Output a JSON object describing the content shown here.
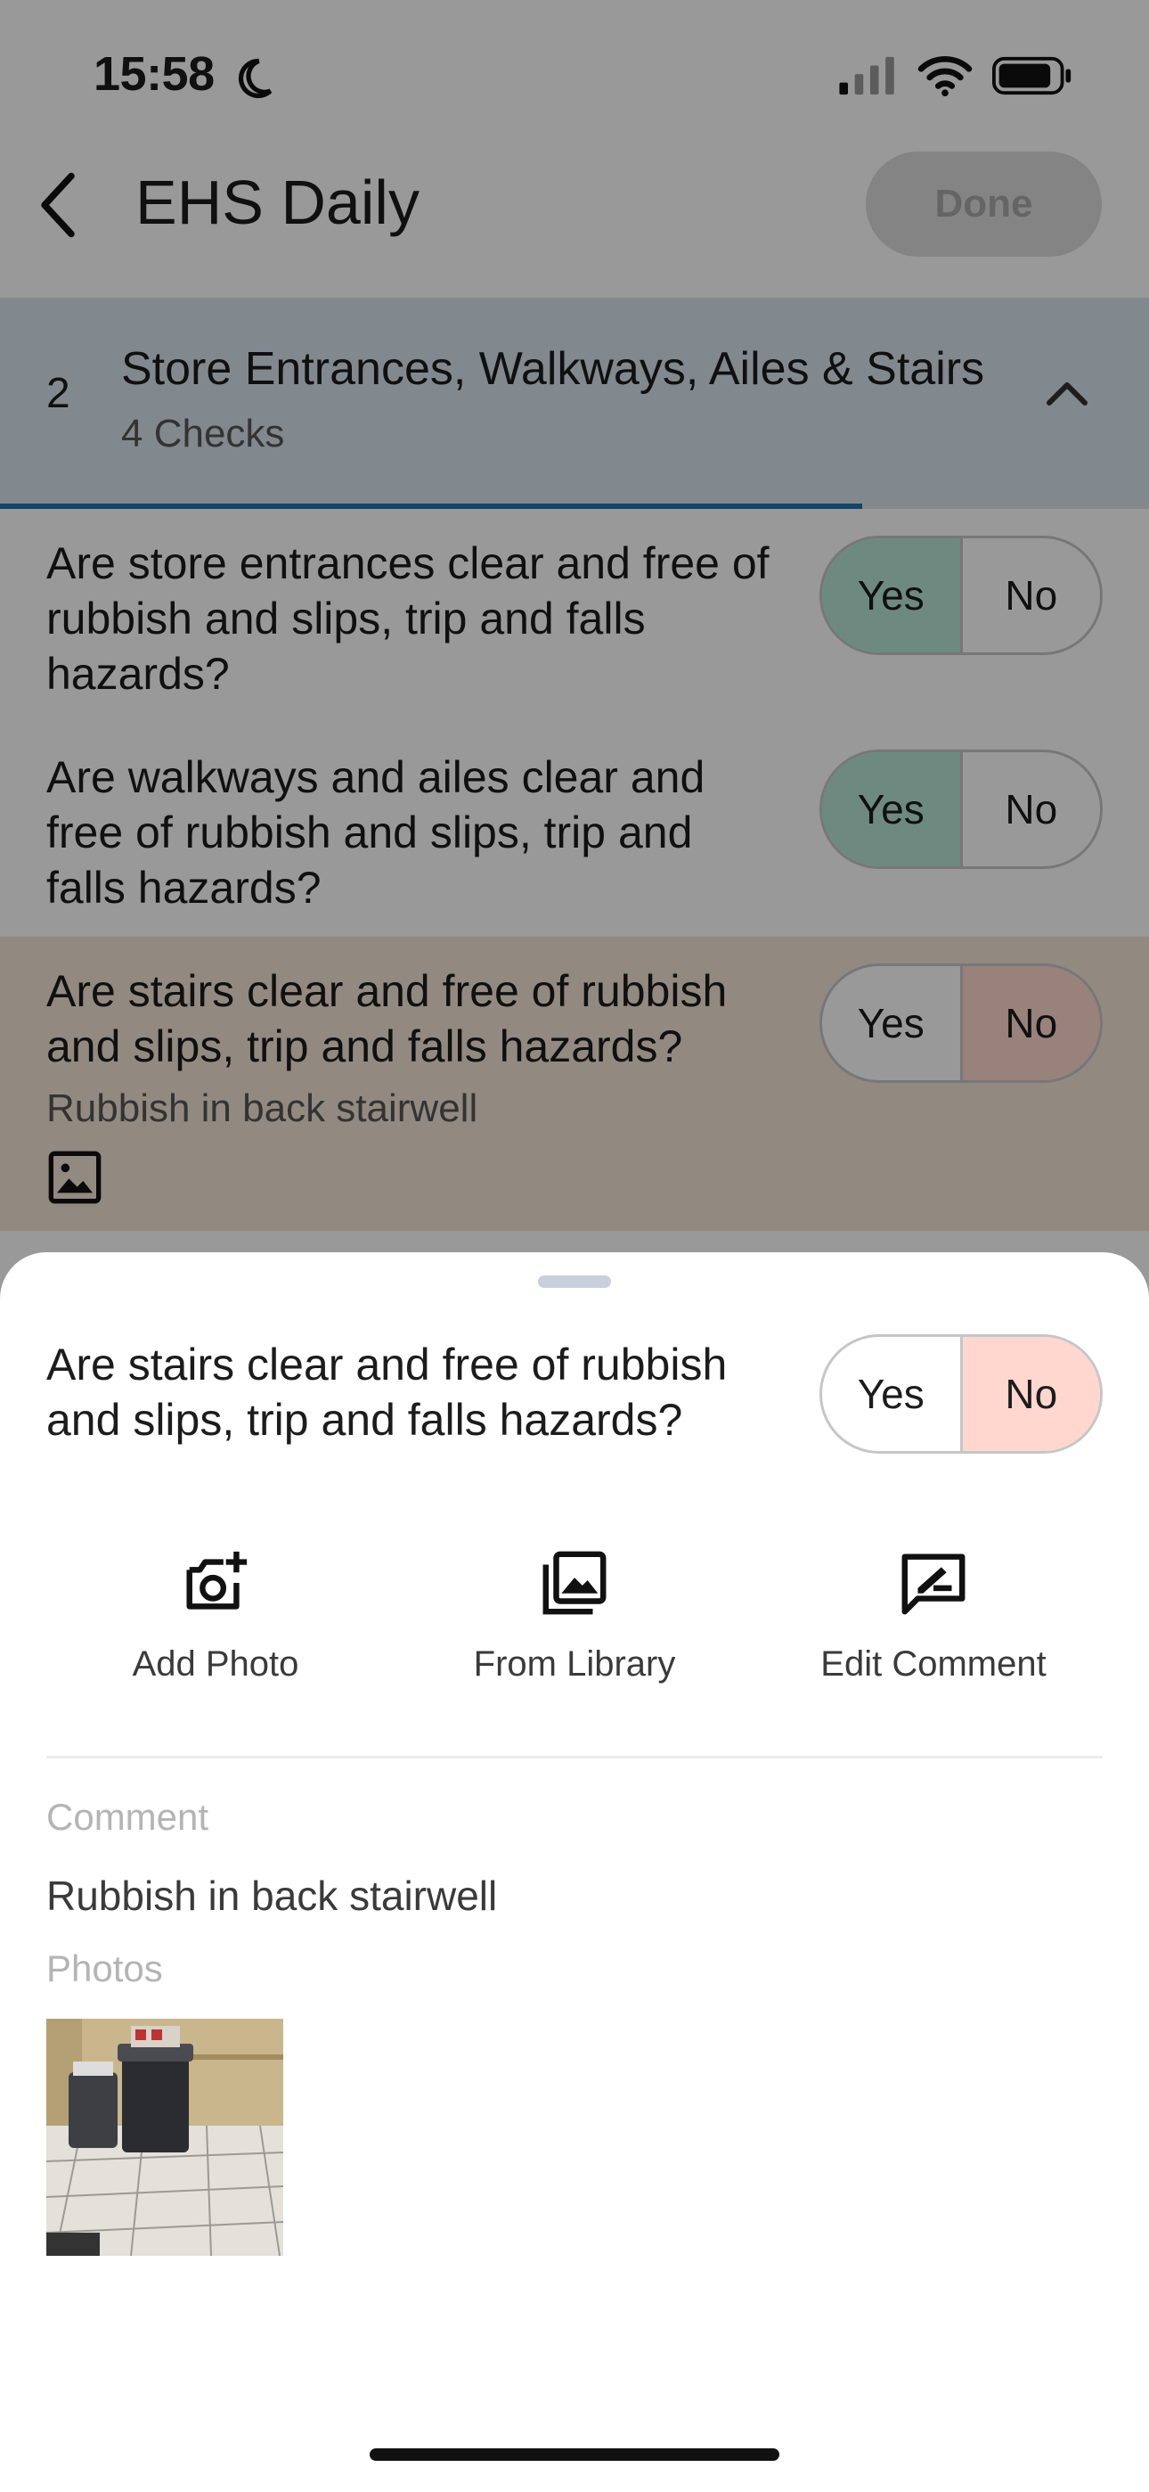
{
  "status_bar": {
    "time": "15:58",
    "icons": [
      "moon-icon",
      "cellular-signal-icon",
      "wifi-icon",
      "battery-icon"
    ]
  },
  "nav": {
    "back_icon": "chevron-left-icon",
    "title": "EHS Daily",
    "done_label": "Done"
  },
  "section": {
    "number": "2",
    "title": "Store Entrances, Walkways, Ailes & Stairs",
    "subtitle": "4 Checks",
    "expand_icon": "chevron-up-icon",
    "progress_fraction": 0.75
  },
  "questions": [
    {
      "text": "Are store entrances clear and free of rubbish and slips, trip and falls hazards?",
      "yes_label": "Yes",
      "no_label": "No",
      "answer": "Yes"
    },
    {
      "text": "Are walkways and ailes clear and free of rubbish and slips, trip and falls hazards?",
      "yes_label": "Yes",
      "no_label": "No",
      "answer": "Yes"
    },
    {
      "text": "Are stairs clear and free of rubbish and slips, trip and falls hazards?",
      "yes_label": "Yes",
      "no_label": "No",
      "answer": "No",
      "comment": "Rubbish in back stairwell",
      "attachment_icon": "image-icon"
    }
  ],
  "sheet": {
    "question": "Are stairs clear and free of rubbish and slips, trip and falls hazards?",
    "yes_label": "Yes",
    "no_label": "No",
    "answer": "No",
    "actions": [
      {
        "label": "Add Photo",
        "icon": "add-photo-icon"
      },
      {
        "label": "From Library",
        "icon": "photo-library-icon"
      },
      {
        "label": "Edit Comment",
        "icon": "edit-comment-icon"
      }
    ],
    "comment_label": "Comment",
    "comment_text": "Rubbish in back stairwell",
    "photos_label": "Photos"
  },
  "colors": {
    "yes_selected": "#b7e6d6",
    "no_selected": "#ffd7cf",
    "section_header": "#d7e4ee",
    "progress": "#1e73a8",
    "flagged_row": "#f4e4d6"
  }
}
